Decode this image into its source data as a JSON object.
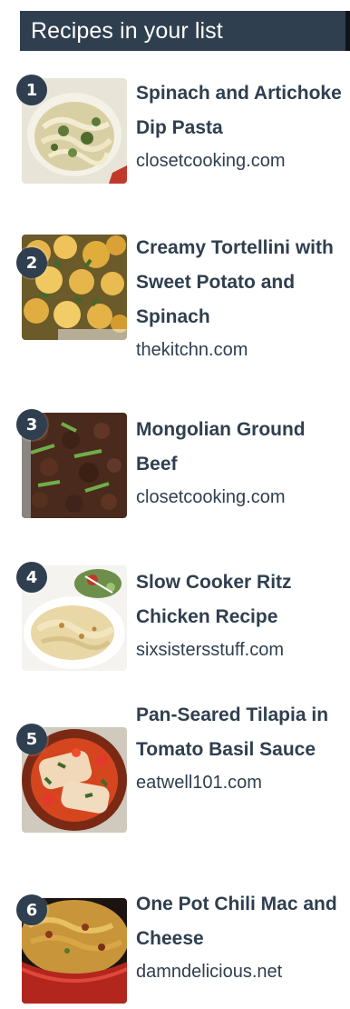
{
  "header": {
    "title": "Recipes in your list"
  },
  "recipes": [
    {
      "number": "1",
      "title": "Spinach and Artichoke Dip Pasta",
      "source": "closetcooking.com",
      "image": "pasta-thumbnail"
    },
    {
      "number": "2",
      "title": "Creamy Tortellini with Sweet Potato and Spinach",
      "source": "thekitchn.com",
      "image": "tortellini-thumbnail"
    },
    {
      "number": "3",
      "title": "Mongolian Ground Beef",
      "source": "closetcooking.com",
      "image": "ground-beef-thumbnail"
    },
    {
      "number": "4",
      "title": "Slow Cooker Ritz Chicken Recipe",
      "source": "sixsistersstuff.com",
      "image": "ritz-chicken-thumbnail"
    },
    {
      "number": "5",
      "title": "Pan-Seared Tilapia in Tomato Basil Sauce",
      "source": "eatwell101.com",
      "image": "tilapia-thumbnail"
    },
    {
      "number": "6",
      "title": "One Pot Chili Mac and Cheese",
      "source": "damndelicious.net",
      "image": "chili-mac-thumbnail"
    }
  ],
  "colors": {
    "header_bg": "#2f3f4f",
    "text": "#2f3f4f",
    "badge_bg": "#2f3f4f"
  }
}
